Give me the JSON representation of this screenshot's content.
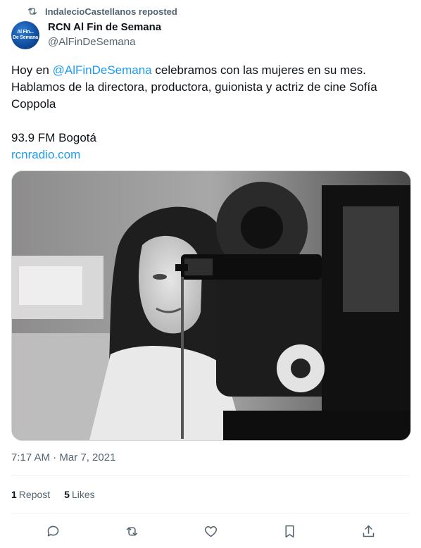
{
  "repost_banner": {
    "icon": "repost-icon",
    "text": "IndalecioCastellanos reposted"
  },
  "author": {
    "avatar_line1": "Al Fin...",
    "avatar_line2": "De Semana",
    "name": "RCN Al Fin de Semana",
    "handle": "@AlFinDeSemana"
  },
  "tweet": {
    "text_prefix": "Hoy en ",
    "mention": "@AlFinDeSemana",
    "text_suffix": " celebramos con las mujeres en su mes. Hablamos de la directora, productora, guionista y actriz de cine Sofía Coppola",
    "station": "93.9 FM Bogotá",
    "link": "rcnradio.com"
  },
  "timestamp": "7:17 AM · Mar 7, 2021",
  "stats": {
    "reposts_count": "1",
    "reposts_label": "Repost",
    "likes_count": "5",
    "likes_label": "Likes"
  },
  "actions": [
    "reply-icon",
    "repost-icon",
    "like-icon",
    "bookmark-icon",
    "share-icon"
  ]
}
